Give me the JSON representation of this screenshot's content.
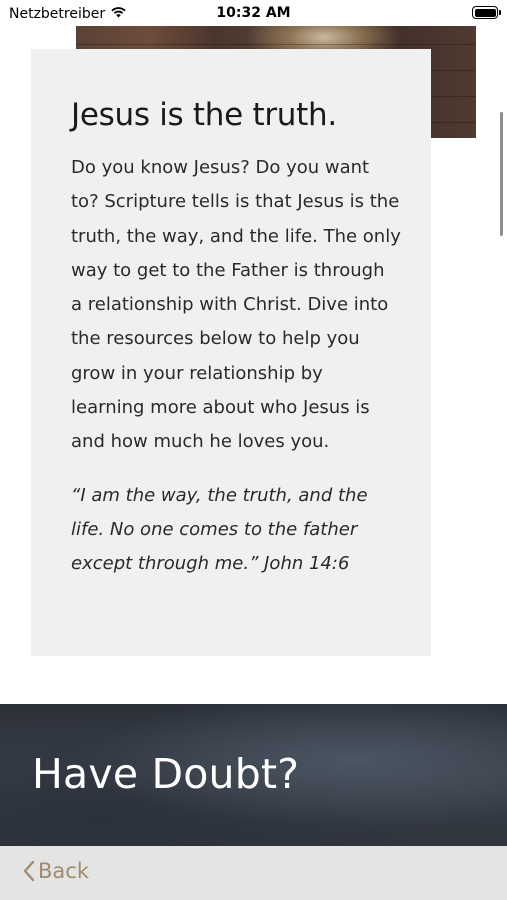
{
  "status_bar": {
    "carrier": "Netzbetreiber",
    "time": "10:32 AM"
  },
  "card": {
    "title": "Jesus is the truth.",
    "body": "Do you know Jesus? Do you want to? Scripture tells is that Jesus is the truth, the way, and the life. The only way to get to the Father is through a relationship with Christ. Dive into the resources below to help you grow in your relationship by learning more about who Jesus is and how much he loves you.",
    "quote": "“I am the way, the truth, and the life. No one comes to the father except through me.” John 14:6"
  },
  "doubt_section": {
    "title": "Have Doubt?"
  },
  "toolbar": {
    "back_label": "Back"
  },
  "colors": {
    "accent": "#a28a6c",
    "card_background": "#f0f0f0",
    "toolbar_background": "#e4e4e4",
    "doubt_background": "#343a44"
  },
  "icons": {
    "wifi": "wifi-icon",
    "battery": "battery-icon",
    "back": "chevron-left-icon"
  }
}
